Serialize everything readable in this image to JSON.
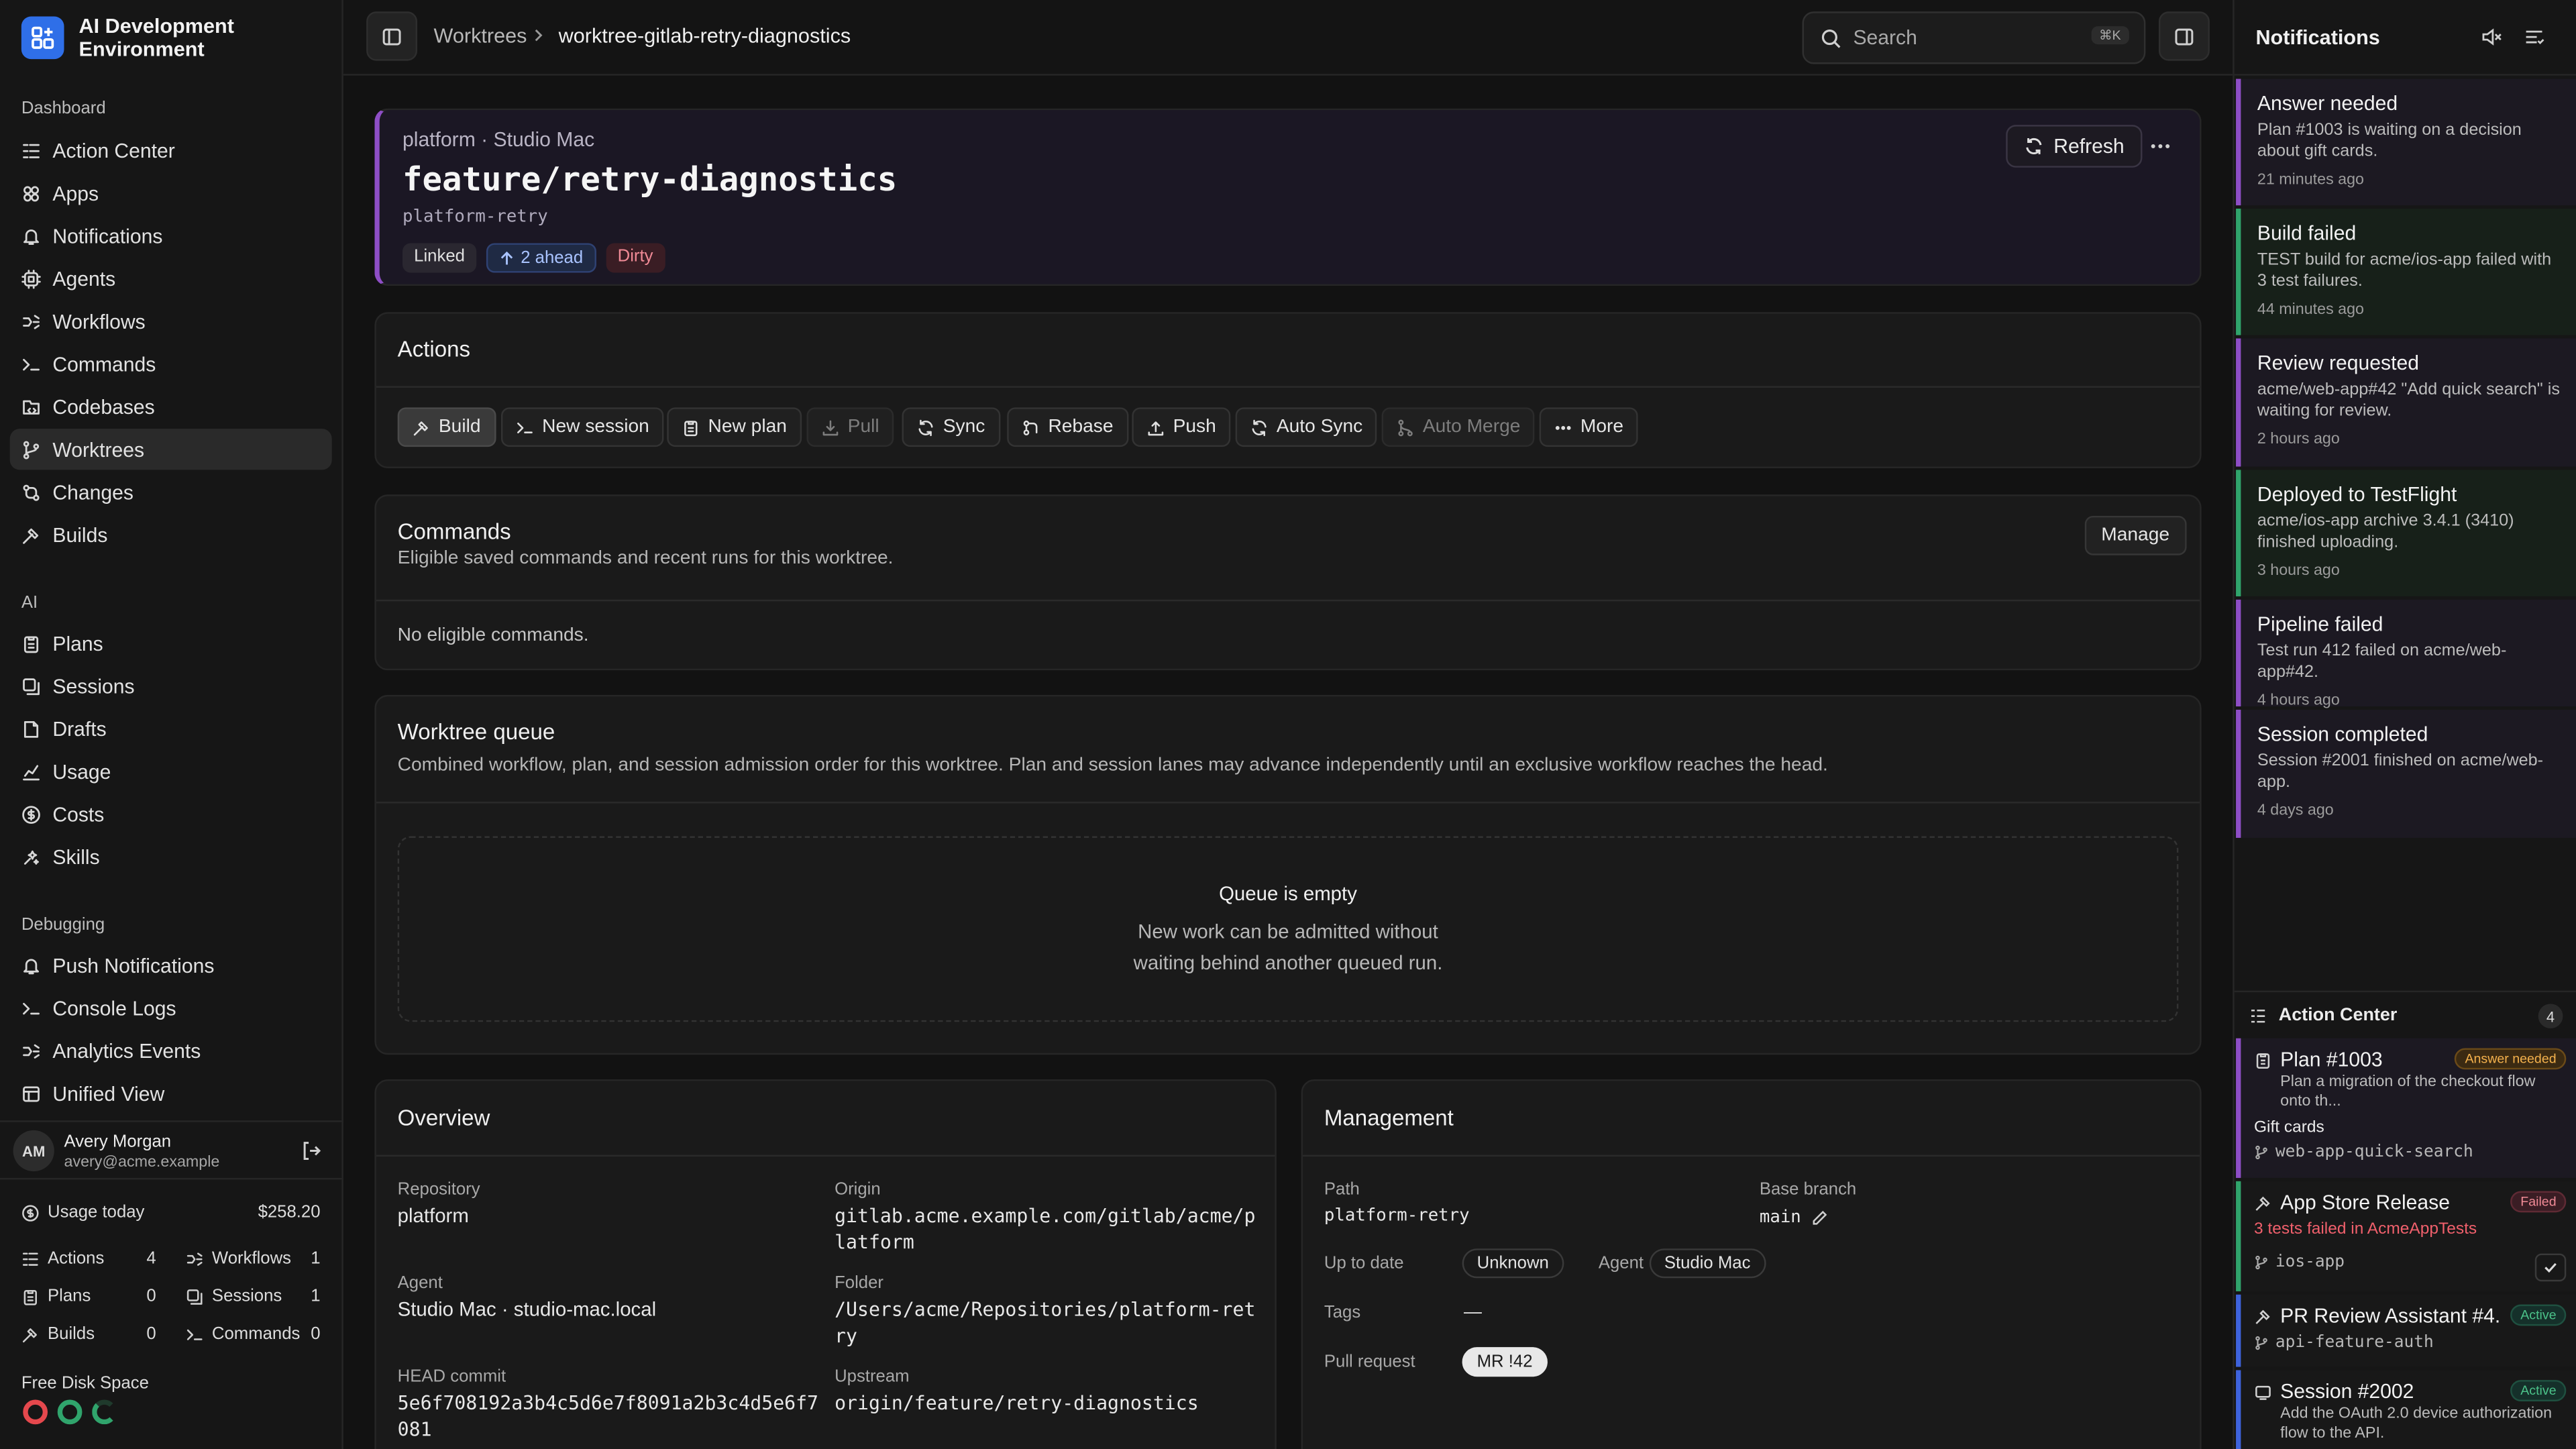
{
  "app": {
    "title": "AI Development Environment"
  },
  "sidebar": {
    "sections": [
      {
        "label": "Dashboard",
        "items": [
          {
            "label": "Action Center",
            "icon": "action-center-icon"
          },
          {
            "label": "Apps",
            "icon": "apps-icon"
          },
          {
            "label": "Notifications",
            "icon": "bell-icon"
          },
          {
            "label": "Agents",
            "icon": "agent-icon"
          },
          {
            "label": "Workflows",
            "icon": "workflow-icon"
          },
          {
            "label": "Commands",
            "icon": "terminal-icon"
          },
          {
            "label": "Codebases",
            "icon": "codebase-icon"
          },
          {
            "label": "Worktrees",
            "icon": "branch-icon",
            "active": true
          },
          {
            "label": "Changes",
            "icon": "changes-icon"
          },
          {
            "label": "Builds",
            "icon": "hammer-icon"
          }
        ]
      },
      {
        "label": "AI",
        "items": [
          {
            "label": "Plans",
            "icon": "clipboard-icon"
          },
          {
            "label": "Sessions",
            "icon": "sessions-icon"
          },
          {
            "label": "Drafts",
            "icon": "drafts-icon"
          },
          {
            "label": "Usage",
            "icon": "chart-icon"
          },
          {
            "label": "Costs",
            "icon": "dollar-icon"
          },
          {
            "label": "Skills",
            "icon": "skills-icon"
          }
        ]
      },
      {
        "label": "Debugging",
        "items": [
          {
            "label": "Push Notifications",
            "icon": "bell-icon"
          },
          {
            "label": "Console Logs",
            "icon": "terminal-icon"
          },
          {
            "label": "Analytics Events",
            "icon": "workflow-icon"
          },
          {
            "label": "Unified View",
            "icon": "unified-icon"
          }
        ]
      }
    ],
    "user": {
      "initials": "AM",
      "name": "Avery Morgan",
      "email": "avery@acme.example"
    },
    "usage": {
      "label": "Usage today",
      "value": "$258.20"
    },
    "stats": [
      {
        "label": "Actions",
        "value": "4",
        "icon": "action-center-icon"
      },
      {
        "label": "Workflows",
        "value": "1",
        "icon": "workflow-icon"
      },
      {
        "label": "Plans",
        "value": "0",
        "icon": "clipboard-icon"
      },
      {
        "label": "Sessions",
        "value": "1",
        "icon": "sessions-icon"
      },
      {
        "label": "Builds",
        "value": "0",
        "icon": "hammer-icon"
      },
      {
        "label": "Commands",
        "value": "0",
        "icon": "terminal-icon"
      }
    ],
    "disk_label": "Free Disk Space",
    "disk_colors": [
      "#e5484d",
      "#30a46c",
      "#30a46c"
    ]
  },
  "topbar": {
    "breadcrumb": [
      "Worktrees",
      "worktree-gitlab-retry-diagnostics"
    ],
    "search_placeholder": "Search",
    "search_shortcut": "⌘K"
  },
  "header": {
    "context": "platform · Studio Mac",
    "branch": "feature/retry-diagnostics",
    "slug": "platform-retry",
    "badges": [
      "Linked",
      "2 ahead",
      "Dirty"
    ],
    "refresh_label": "Refresh"
  },
  "actions": {
    "title": "Actions",
    "buttons": [
      {
        "label": "Build",
        "icon": "hammer-icon",
        "state": "primary"
      },
      {
        "label": "New session",
        "icon": "terminal-icon",
        "state": "normal"
      },
      {
        "label": "New plan",
        "icon": "clipboard-icon",
        "state": "normal"
      },
      {
        "label": "Pull",
        "icon": "download-icon",
        "state": "disabled"
      },
      {
        "label": "Sync",
        "icon": "sync-icon",
        "state": "normal"
      },
      {
        "label": "Rebase",
        "icon": "rebase-icon",
        "state": "normal"
      },
      {
        "label": "Push",
        "icon": "upload-icon",
        "state": "normal"
      },
      {
        "label": "Auto Sync",
        "icon": "sync-icon",
        "state": "normal"
      },
      {
        "label": "Auto Merge",
        "icon": "merge-icon",
        "state": "disabled"
      },
      {
        "label": "More",
        "icon": "ellipsis-icon",
        "state": "normal"
      }
    ]
  },
  "commands": {
    "title": "Commands",
    "subtitle": "Eligible saved commands and recent runs for this worktree.",
    "manage_label": "Manage",
    "empty": "No eligible commands."
  },
  "queue": {
    "title": "Worktree queue",
    "subtitle": "Combined workflow, plan, and session admission order for this worktree. Plan and session lanes may advance independently until an exclusive workflow reaches the head.",
    "empty_title": "Queue is empty",
    "empty_text_1": "New work can be admitted without",
    "empty_text_2": "waiting behind another queued run."
  },
  "overview": {
    "title": "Overview",
    "repository_label": "Repository",
    "repository": "platform",
    "origin_label": "Origin",
    "origin_1": "gitlab.acme.example.com/gitlab/acme/p",
    "origin_2": "latform",
    "agent_label": "Agent",
    "agent": "Studio Mac · studio-mac.local",
    "folder_label": "Folder",
    "folder_1": "/Users/acme/Repositories/platform-ret",
    "folder_2": "ry",
    "head_label": "HEAD commit",
    "head_1": "5e6f708192a3b4c5d6e7f8091a2b3c4d5e6f7",
    "head_2": "081",
    "upstream_label": "Upstream",
    "upstream": "origin/feature/retry-diagnostics"
  },
  "management": {
    "title": "Management",
    "path_label": "Path",
    "path": "platform-retry",
    "base_label": "Base branch",
    "base": "main",
    "uptodate_label": "Up to date",
    "uptodate": "Unknown",
    "agent_label": "Agent",
    "agent": "Studio Mac",
    "tags_label": "Tags",
    "tags": "—",
    "pr_label": "Pull request",
    "pr": "MR !42"
  },
  "notifications": {
    "title": "Notifications",
    "items": [
      {
        "title": "Answer needed",
        "text": "Plan #1003 is waiting on a decision about gift cards.",
        "time": "21 minutes ago",
        "color": "#8e4ec6"
      },
      {
        "title": "Build failed",
        "text": "TEST build for acme/ios-app failed with 3 test failures.",
        "time": "44 minutes ago",
        "color": "#30a46c"
      },
      {
        "title": "Review requested",
        "text": "acme/web-app#42 \"Add quick search\" is waiting for review.",
        "time": "2 hours ago",
        "color": "#8e4ec6"
      },
      {
        "title": "Deployed to TestFlight",
        "text": "acme/ios-app archive 3.4.1 (3410) finished uploading.",
        "time": "3 hours ago",
        "color": "#30a46c"
      },
      {
        "title": "Pipeline failed",
        "text": "Test run 412 failed on acme/web-app#42.",
        "time": "4 hours ago",
        "color": "#8e4ec6"
      },
      {
        "title": "Session completed",
        "text": "Session #2001 finished on acme/web-app.",
        "time": "4 days ago",
        "color": "#8e4ec6"
      }
    ]
  },
  "action_center": {
    "title": "Action Center",
    "count": "4",
    "items": [
      {
        "title": "Plan #1003",
        "tag": "Answer needed",
        "text": "Plan a migration of the checkout flow onto th...",
        "extra": "Gift cards",
        "branch": "web-app-quick-search",
        "color": "#8e4ec6"
      },
      {
        "title": "App Store Release",
        "tag": "Failed",
        "text": "3 tests failed in AcmeAppTests",
        "branch": "ios-app",
        "color": "#30a46c"
      },
      {
        "title": "PR Review Assistant #4...",
        "tag": "Active",
        "branch": "api-feature-auth",
        "color": "#3e63dd"
      },
      {
        "title": "Session #2002",
        "tag": "Active",
        "text": "Add the OAuth 2.0 device authorization flow to the API.",
        "color": "#3e63dd"
      }
    ]
  }
}
